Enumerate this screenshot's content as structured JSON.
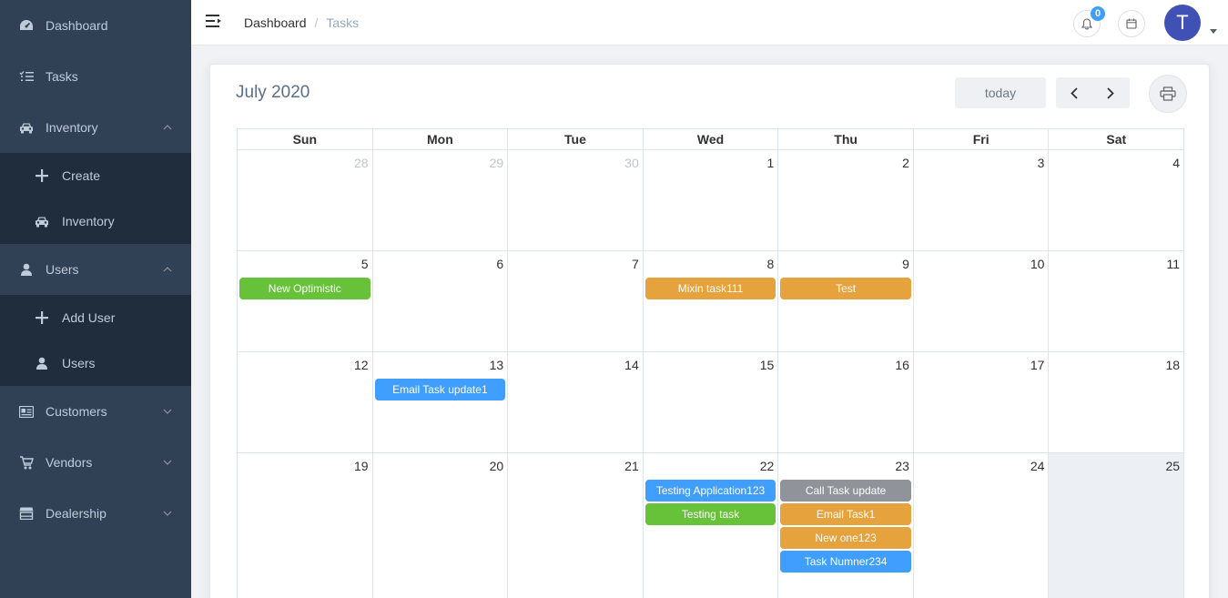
{
  "sidebar": {
    "items": [
      {
        "label": "Dashboard",
        "icon": "dashboard-icon"
      },
      {
        "label": "Tasks",
        "icon": "tasks-icon"
      },
      {
        "label": "Inventory",
        "icon": "car-icon",
        "expanded": true,
        "children": [
          {
            "label": "Create",
            "icon": "plus-icon"
          },
          {
            "label": "Inventory",
            "icon": "car-icon"
          }
        ]
      },
      {
        "label": "Users",
        "icon": "user-icon",
        "expanded": true,
        "children": [
          {
            "label": "Add User",
            "icon": "plus-icon"
          },
          {
            "label": "Users",
            "icon": "user-icon"
          }
        ]
      },
      {
        "label": "Customers",
        "icon": "id-card-icon",
        "expanded": false
      },
      {
        "label": "Vendors",
        "icon": "cart-icon",
        "expanded": false
      },
      {
        "label": "Dealership",
        "icon": "store-icon",
        "expanded": false
      }
    ]
  },
  "header": {
    "breadcrumb": {
      "home": "Dashboard",
      "separator": "/",
      "current": "Tasks"
    },
    "notifications": {
      "count": "0"
    },
    "avatar": {
      "initial": "T",
      "color": "#3f51b5"
    }
  },
  "calendar": {
    "title": "July 2020",
    "today_label": "today",
    "weekdays": [
      "Sun",
      "Mon",
      "Tue",
      "Wed",
      "Thu",
      "Fri",
      "Sat"
    ],
    "weeks": [
      [
        {
          "day": "28",
          "other": true
        },
        {
          "day": "29",
          "other": true
        },
        {
          "day": "30",
          "other": true
        },
        {
          "day": "1"
        },
        {
          "day": "2"
        },
        {
          "day": "3"
        },
        {
          "day": "4"
        }
      ],
      [
        {
          "day": "5",
          "events": [
            {
              "title": "New Optimistic",
              "color": "#67c23a"
            }
          ]
        },
        {
          "day": "6"
        },
        {
          "day": "7"
        },
        {
          "day": "8",
          "events": [
            {
              "title": "Mixin task111",
              "color": "#e6a23c"
            }
          ]
        },
        {
          "day": "9",
          "events": [
            {
              "title": "Test",
              "color": "#e6a23c"
            }
          ]
        },
        {
          "day": "10"
        },
        {
          "day": "11"
        }
      ],
      [
        {
          "day": "12"
        },
        {
          "day": "13",
          "events": [
            {
              "title": "Email Task update1",
              "color": "#409eff"
            }
          ]
        },
        {
          "day": "14"
        },
        {
          "day": "15"
        },
        {
          "day": "16"
        },
        {
          "day": "17"
        },
        {
          "day": "18"
        }
      ],
      [
        {
          "day": "19"
        },
        {
          "day": "20"
        },
        {
          "day": "21"
        },
        {
          "day": "22",
          "events": [
            {
              "title": "Testing Application123",
              "color": "#409eff"
            },
            {
              "title": "Testing task",
              "color": "#67c23a"
            }
          ]
        },
        {
          "day": "23",
          "events": [
            {
              "title": "Call Task update",
              "color": "#909399"
            },
            {
              "title": "Email Task1",
              "color": "#e6a23c"
            },
            {
              "title": "New one123",
              "color": "#e6a23c"
            },
            {
              "title": "Task Numner234",
              "color": "#409eff"
            }
          ]
        },
        {
          "day": "24"
        },
        {
          "day": "25",
          "today": true
        }
      ]
    ]
  }
}
